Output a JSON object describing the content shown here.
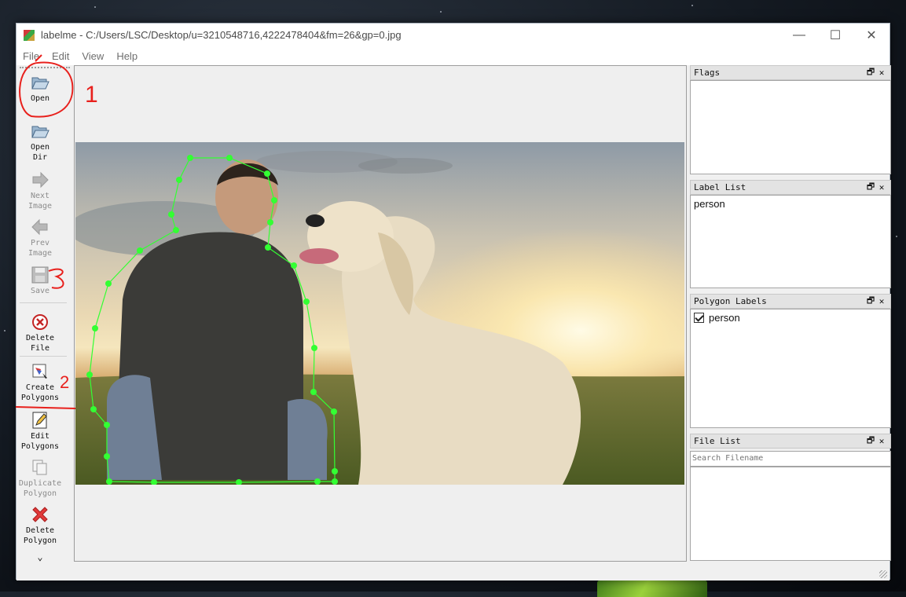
{
  "window": {
    "title": "labelme - C:/Users/LSC/Desktop/u=3210548716,4222478404&fm=26&gp=0.jpg",
    "controls": {
      "minimize": "—",
      "maximize": "☐",
      "close": "✕"
    }
  },
  "menu": [
    {
      "label": "File"
    },
    {
      "label": "Edit"
    },
    {
      "label": "View"
    },
    {
      "label": "Help"
    }
  ],
  "toolbar": {
    "open": "Open",
    "open_dir": "Open\nDir",
    "next_image": "Next\nImage",
    "prev_image": "Prev\nImage",
    "save": "Save",
    "delete_file": "Delete\nFile",
    "create_polygons": "Create\nPolygons",
    "edit_polygons": "Edit\nPolygons",
    "duplicate_polygon": "Duplicate\nPolygon",
    "delete_polygon": "Delete\nPolygon",
    "more": "⌄"
  },
  "docks": {
    "flags": {
      "title": "Flags"
    },
    "label_list": {
      "title": "Label List",
      "items": [
        "person"
      ]
    },
    "polygon_labels": {
      "title": "Polygon Labels",
      "items": [
        {
          "label": "person",
          "checked": true
        }
      ]
    },
    "file_list": {
      "title": "File List",
      "search_placeholder": "Search Filename"
    },
    "float_icon": "🗗",
    "close_icon": "✕"
  },
  "annotations": {
    "step1": "1",
    "step2": "2",
    "step3": "3"
  },
  "colors": {
    "polygon": "#33ff33",
    "annotation": "#e8201c"
  }
}
